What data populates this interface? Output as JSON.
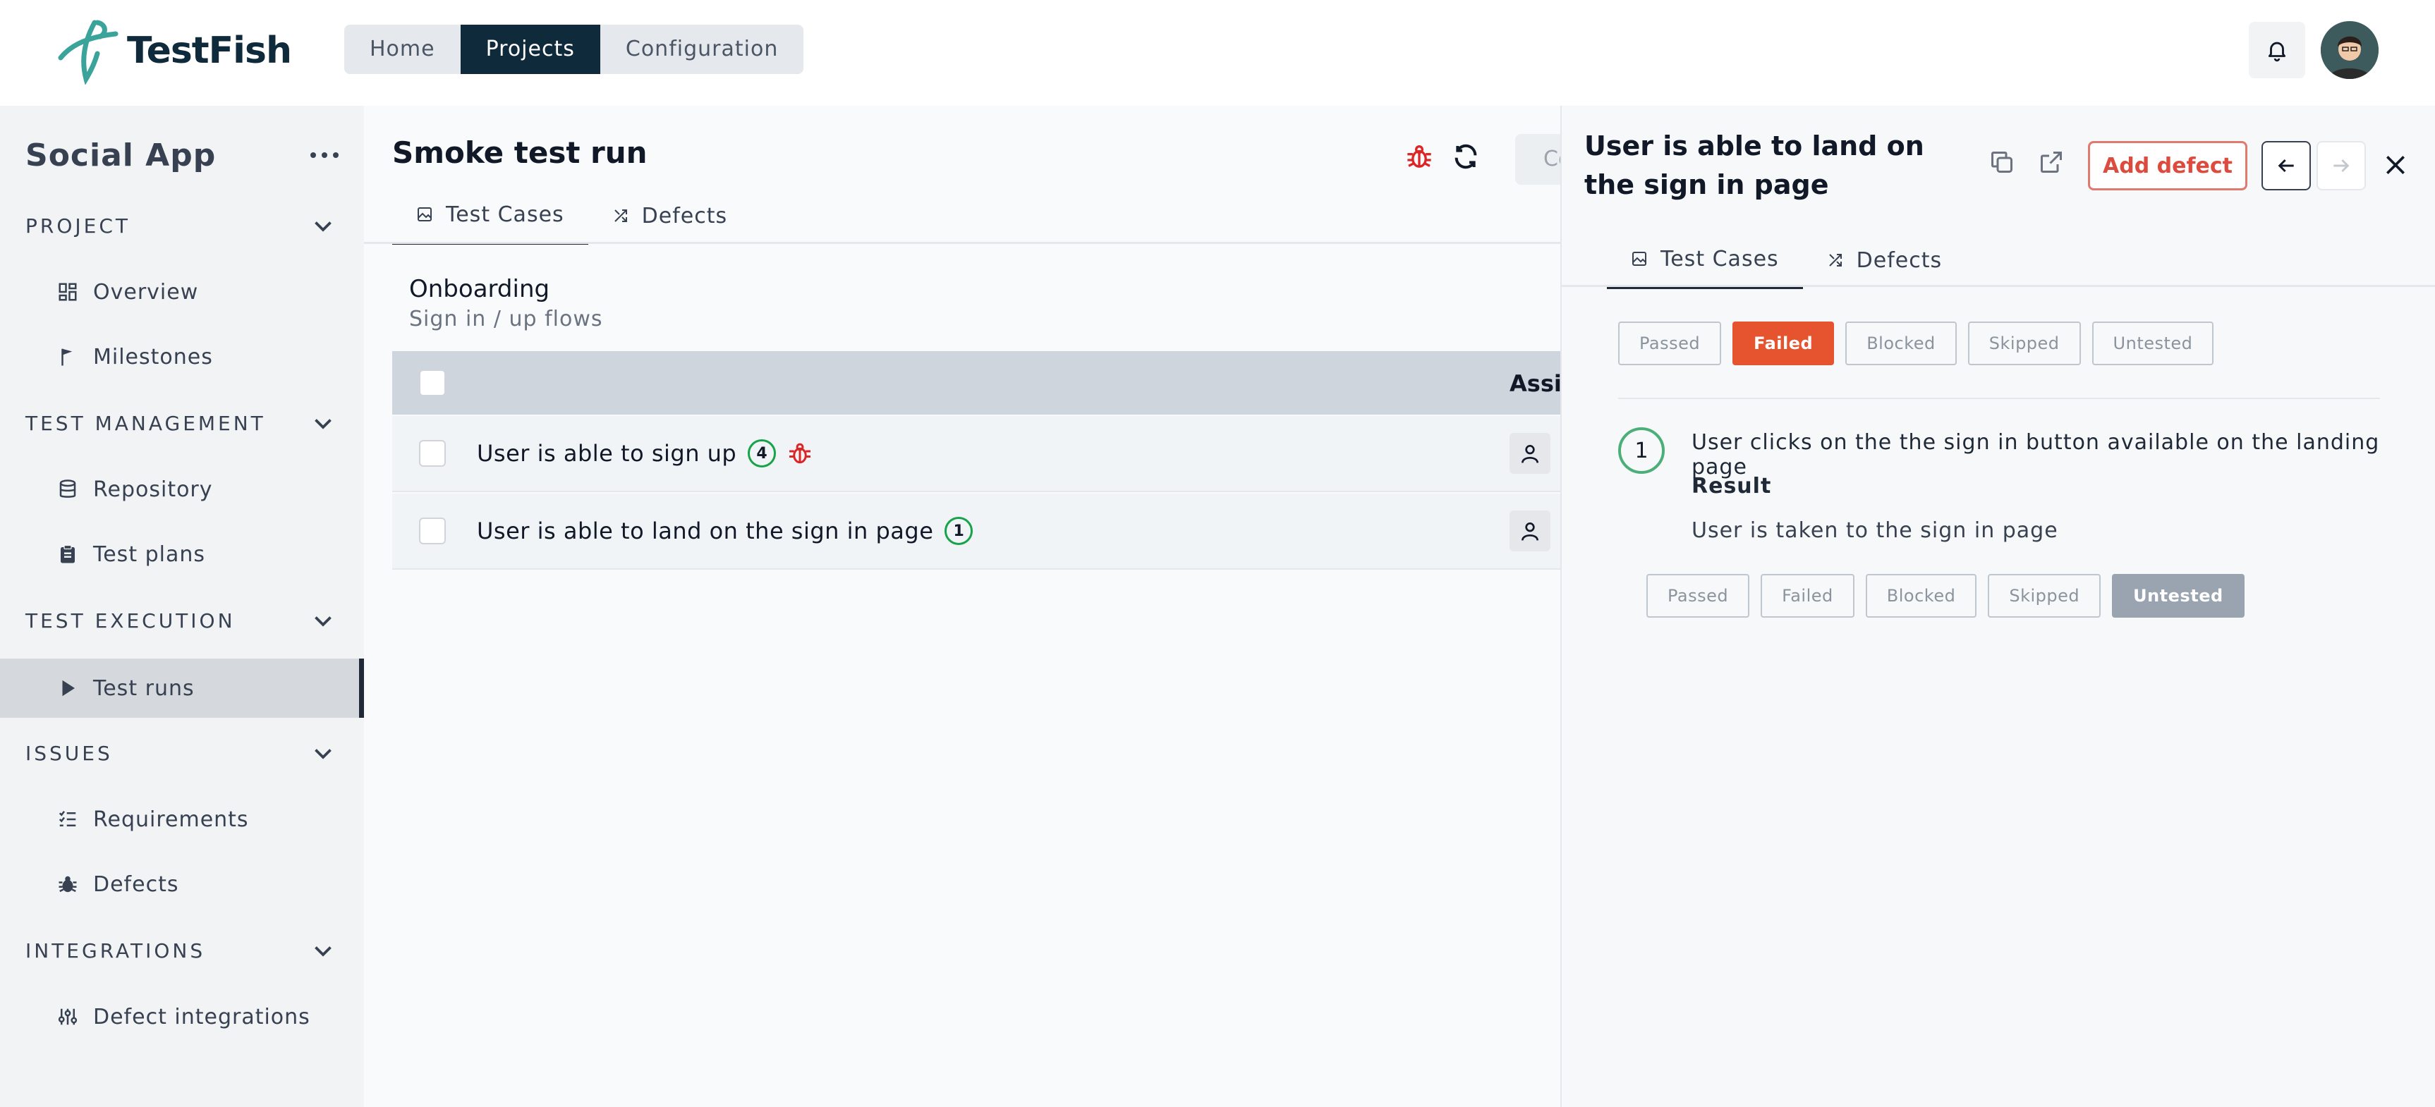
{
  "header": {
    "logo_text": "TestFish",
    "nav": [
      {
        "label": "Home",
        "active": false
      },
      {
        "label": "Projects",
        "active": true
      },
      {
        "label": "Configuration",
        "active": false
      }
    ],
    "icons": [
      "bell-icon",
      "user-avatar"
    ]
  },
  "sidebar": {
    "project_name": "Social App",
    "sections": {
      "project": "PROJECT",
      "test_management": "TEST MANAGEMENT",
      "test_execution": "TEST EXECUTION",
      "issues": "ISSUES",
      "integrations": "INTEGRATIONS"
    },
    "items": {
      "overview": "Overview",
      "milestones": "Milestones",
      "repository": "Repository",
      "test_plans": "Test plans",
      "test_runs": "Test runs",
      "requirements": "Requirements",
      "defects": "Defects",
      "defect_integrations": "Defect integrations"
    },
    "active_item": "Test runs"
  },
  "main": {
    "title": "Smoke test run",
    "ghost_button": "Co",
    "tabs": {
      "test_cases": "Test Cases",
      "defects": "Defects"
    },
    "suite": {
      "title": "Onboarding",
      "subtitle": "Sign in / up flows"
    },
    "table": {
      "assignee_header": "Assigne",
      "rows": [
        {
          "title": "User is able to sign up",
          "count": "4",
          "has_defect": true
        },
        {
          "title": "User is able to land on the sign in page",
          "count": "1",
          "has_defect": false
        }
      ]
    }
  },
  "drawer": {
    "title": "User is able to land on the sign in page",
    "add_defect": "Add defect",
    "tabs": {
      "test_cases": "Test Cases",
      "defects": "Defects"
    },
    "status": {
      "passed": "Passed",
      "failed": "Failed",
      "blocked": "Blocked",
      "skipped": "Skipped",
      "untested": "Untested",
      "selected": "Failed"
    },
    "step": {
      "number": "1",
      "text": "User clicks on the the sign in button available on the landing page",
      "result_label": "Result",
      "result_text": "User is taken to the sign in page",
      "selected": "Untested"
    }
  },
  "colors": {
    "brand_dark": "#0f2a3a",
    "failed": "#e5532f",
    "untested_selected": "#9aa3b0",
    "badge_green": "#16a34a",
    "defect_red": "#dc2626"
  }
}
